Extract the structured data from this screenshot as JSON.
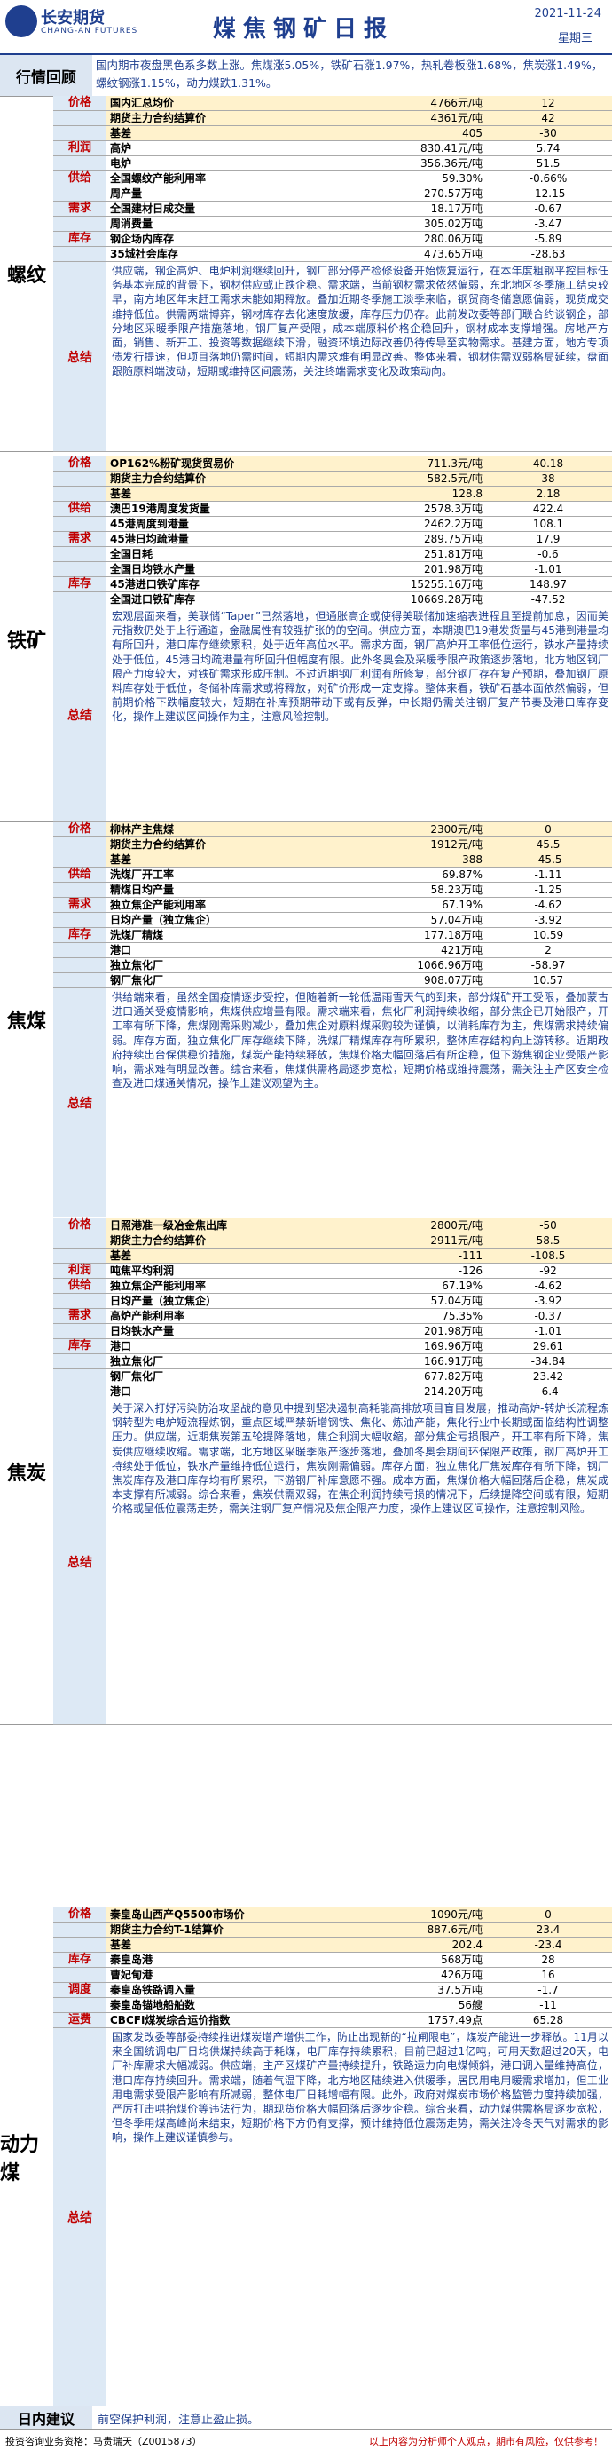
{
  "header": {
    "company_cn": "长安期货",
    "company_en": "CHANG-AN FUTURES",
    "title": "煤焦钢矿日报",
    "date": "2021-11-24",
    "weekday": "星期三"
  },
  "review": {
    "label": "行情回顾",
    "text": "国内期市夜盘黑色系多数上涨。焦煤涨5.05%，铁矿石涨1.97%，热轧卷板涨1.68%，焦炭涨1.49%，螺纹钢涨1.15%，动力煤跌1.31%。"
  },
  "sections": [
    {
      "name": "螺纹",
      "rows": [
        {
          "cat": "价格",
          "label": "国内汇总均价",
          "value": "4766元/吨",
          "change": "12",
          "hl": true
        },
        {
          "cat": "价格",
          "label": "期货主力合约结算价",
          "value": "4361元/吨",
          "change": "42",
          "hl": true
        },
        {
          "cat": "价格",
          "label": "基差",
          "value": "405",
          "change": "-30",
          "hl": true
        },
        {
          "cat": "利润",
          "label": "高炉",
          "value": "830.41元/吨",
          "change": "5.74",
          "hl": false
        },
        {
          "cat": "利润",
          "label": "电炉",
          "value": "356.36元/吨",
          "change": "51.5",
          "hl": false
        },
        {
          "cat": "供给",
          "label": "全国螺纹产能利用率",
          "value": "59.30%",
          "change": "-0.66%",
          "hl": false
        },
        {
          "cat": "供给",
          "label": "周产量",
          "value": "270.57万吨",
          "change": "-12.15",
          "hl": false
        },
        {
          "cat": "需求",
          "label": "全国建材日成交量",
          "value": "18.17万吨",
          "change": "-0.67",
          "hl": false
        },
        {
          "cat": "需求",
          "label": "周消费量",
          "value": "305.02万吨",
          "change": "-3.47",
          "hl": false
        },
        {
          "cat": "库存",
          "label": "钢企场内库存",
          "value": "280.06万吨",
          "change": "-5.89",
          "hl": false
        },
        {
          "cat": "库存",
          "label": "35城社会库存",
          "value": "473.65万吨",
          "change": "-28.63",
          "hl": false
        }
      ],
      "summary_label": "总结",
      "summary": "供应端，钢企高炉、电炉利润继续回升，钢厂部分停产检修设备开始恢复运行，在本年度粗钢平控目标任务基本完成的背景下，钢材供应或止跌企稳。需求端，当前钢材需求依然偏弱，东北地区冬季施工结束较早，南方地区年末赶工需求未能如期释放。叠加近期冬季施工淡季来临，钢贸商冬储意愿偏弱，现货成交维持低位。供需两端博弈，钢材库存去化速度放缓，库存压力仍存。此前发改委等部门联合约谈钢企，部分地区采暖季限产措施落地，钢厂复产受限，成本端原料价格企稳回升，钢材成本支撑增强。房地产方面，销售、新开工、投资等数据继续下滑，融资环境边际改善仍待传导至实物需求。基建方面，地方专项债发行提速，但项目落地仍需时间，短期内需求难有明显改善。整体来看，钢材供需双弱格局延续，盘面跟随原料端波动，短期或维持区间震荡，关注终端需求变化及政策动向。"
    },
    {
      "name": "铁矿",
      "rows": [
        {
          "cat": "价格",
          "label": "OP162%粉矿现货贸易价",
          "value": "711.3元/吨",
          "change": "40.18",
          "hl": true
        },
        {
          "cat": "价格",
          "label": "期货主力合约结算价",
          "value": "582.5元/吨",
          "change": "38",
          "hl": true
        },
        {
          "cat": "价格",
          "label": "基差",
          "value": "128.8",
          "change": "2.18",
          "hl": true
        },
        {
          "cat": "供给",
          "label": "澳巴19港周度发货量",
          "value": "2578.3万吨",
          "change": "422.4",
          "hl": false
        },
        {
          "cat": "供给",
          "label": "45港周度到港量",
          "value": "2462.2万吨",
          "change": "108.1",
          "hl": false
        },
        {
          "cat": "需求",
          "label": "45港日均疏港量",
          "value": "289.75万吨",
          "change": "17.9",
          "hl": false
        },
        {
          "cat": "需求",
          "label": "全国日耗",
          "value": "251.81万吨",
          "change": "-0.6",
          "hl": false
        },
        {
          "cat": "需求",
          "label": "全国日均铁水产量",
          "value": "201.98万吨",
          "change": "-1.01",
          "hl": false
        },
        {
          "cat": "库存",
          "label": "45港进口铁矿库存",
          "value": "15255.16万吨",
          "change": "148.97",
          "hl": false
        },
        {
          "cat": "库存",
          "label": "全国进口铁矿库存",
          "value": "10669.28万吨",
          "change": "-47.52",
          "hl": false
        }
      ],
      "summary_label": "总结",
      "summary": "宏观层面来看，美联储“Taper”已然落地，但通胀高企或使得美联储加速缩表进程且至提前加息，因而美元指数仍处于上行通道，金融属性有较强扩张的的空间。供应方面，本期澳巴19港发货量与45港到港量均有所回升，港口库存继续累积，处于近年高位水平。需求方面，钢厂高炉开工率低位运行，铁水产量持续处于低位，45港日均疏港量有所回升但幅度有限。此外冬奥会及采暖季限产政策逐步落地，北方地区钢厂限产力度较大，对铁矿需求形成压制。不过近期钢厂利润有所修复，部分钢厂存在复产预期，叠加钢厂原料库存处于低位，冬储补库需求或将释放，对矿价形成一定支撑。整体来看，铁矿石基本面依然偏弱，但前期价格下跌幅度较大，短期在补库预期带动下或有反弹，中长期仍需关注钢厂复产节奏及港口库存变化，操作上建议区间操作为主，注意风险控制。"
    },
    {
      "name": "焦煤",
      "rows": [
        {
          "cat": "价格",
          "label": "柳林产主焦煤",
          "value": "2300元/吨",
          "change": "0",
          "hl": true
        },
        {
          "cat": "价格",
          "label": "期货主力合约结算价",
          "value": "1912元/吨",
          "change": "45.5",
          "hl": true
        },
        {
          "cat": "价格",
          "label": "基差",
          "value": "388",
          "change": "-45.5",
          "hl": true
        },
        {
          "cat": "供给",
          "label": "洗煤厂开工率",
          "value": "69.87%",
          "change": "-1.11",
          "hl": false
        },
        {
          "cat": "供给",
          "label": "精煤日均产量",
          "value": "58.23万吨",
          "change": "-1.25",
          "hl": false
        },
        {
          "cat": "需求",
          "label": "独立焦企产能利用率",
          "value": "67.19%",
          "change": "-4.62",
          "hl": false
        },
        {
          "cat": "需求",
          "label": "日均产量（独立焦企）",
          "value": "57.04万吨",
          "change": "-3.92",
          "hl": false
        },
        {
          "cat": "库存",
          "label": "洗煤厂精煤",
          "value": "177.18万吨",
          "change": "10.59",
          "hl": false
        },
        {
          "cat": "库存",
          "label": "港口",
          "value": "421万吨",
          "change": "2",
          "hl": false
        },
        {
          "cat": "库存",
          "label": "独立焦化厂",
          "value": "1066.96万吨",
          "change": "-58.97",
          "hl": false
        },
        {
          "cat": "库存",
          "label": "钢厂焦化厂",
          "value": "908.07万吨",
          "change": "10.57",
          "hl": false
        }
      ],
      "summary_label": "总结",
      "summary": "供给端来看，虽然全国疫情逐步受控，但随着新一轮低温雨雪天气的到来，部分煤矿开工受限，叠加蒙古进口通关受疫情影响，焦煤供应增量有限。需求端来看，焦化厂利润持续收缩，部分焦企已开始限产，开工率有所下降，焦煤刚需采购减少，叠加焦企对原料煤采购较为谨慎，以消耗库存为主，焦煤需求持续偏弱。库存方面，独立焦化厂库存继续下降，洗煤厂精煤库存有所累积，整体库存结构向上游转移。近期政府持续出台保供稳价措施，煤炭产能持续释放，焦煤价格大幅回落后有所企稳，但下游焦钢企业受限产影响，需求难有明显改善。综合来看，焦煤供需格局逐步宽松，短期价格或维持震荡，需关注主产区安全检查及进口煤通关情况，操作上建议观望为主。"
    },
    {
      "name": "焦炭",
      "rows": [
        {
          "cat": "价格",
          "label": "日照港准一级冶金焦出库",
          "value": "2800元/吨",
          "change": "-50",
          "hl": true
        },
        {
          "cat": "价格",
          "label": "期货主力合约结算价",
          "value": "2911元/吨",
          "change": "58.5",
          "hl": true
        },
        {
          "cat": "价格",
          "label": "基差",
          "value": "-111",
          "change": "-108.5",
          "hl": true
        },
        {
          "cat": "利润",
          "label": "吨焦平均利润",
          "value": "-126",
          "change": "-92",
          "hl": false
        },
        {
          "cat": "供给",
          "label": "独立焦企产能利用率",
          "value": "67.19%",
          "change": "-4.62",
          "hl": false
        },
        {
          "cat": "供给",
          "label": "日均产量（独立焦企）",
          "value": "57.04万吨",
          "change": "-3.92",
          "hl": false
        },
        {
          "cat": "需求",
          "label": "高炉产能利用率",
          "value": "75.35%",
          "change": "-0.37",
          "hl": false
        },
        {
          "cat": "需求",
          "label": "日均铁水产量",
          "value": "201.98万吨",
          "change": "-1.01",
          "hl": false
        },
        {
          "cat": "库存",
          "label": "港口",
          "value": "169.96万吨",
          "change": "29.61",
          "hl": false
        },
        {
          "cat": "库存",
          "label": "独立焦化厂",
          "value": "166.91万吨",
          "change": "-34.84",
          "hl": false
        },
        {
          "cat": "库存",
          "label": "钢厂焦化厂",
          "value": "677.82万吨",
          "change": "23.42",
          "hl": false
        },
        {
          "cat": "库存",
          "label": "港口",
          "value": "214.20万吨",
          "change": "-6.4",
          "hl": false
        }
      ],
      "summary_label": "总结",
      "summary": "关于深入打好污染防治攻坚战的意见中提到坚决遏制高耗能高排放项目盲目发展，推动高炉-转炉长流程炼钢转型为电炉短流程炼钢，重点区域严禁新增钢铁、焦化、炼油产能，焦化行业中长期或面临结构性调整压力。供应端，近期焦炭第五轮提降落地，焦企利润大幅收缩，部分焦企亏损限产，开工率有所下降，焦炭供应继续收缩。需求端，北方地区采暖季限产逐步落地，叠加冬奥会期间环保限产政策，钢厂高炉开工持续处于低位，铁水产量维持低位运行，焦炭刚需偏弱。库存方面，独立焦化厂焦炭库存有所下降，钢厂焦炭库存及港口库存均有所累积，下游钢厂补库意愿不强。成本方面，焦煤价格大幅回落后企稳，焦炭成本支撑有所减弱。综合来看，焦炭供需双弱，在焦企利润持续亏损的情况下，后续提降空间或有限，短期价格或呈低位震荡走势，需关注钢厂复产情况及焦企限产力度，操作上建议区间操作，注意控制风险。"
    },
    {
      "name": "动力煤",
      "rows": [
        {
          "cat": "价格",
          "label": "秦皇岛山西产Q5500市场价",
          "value": "1090元/吨",
          "change": "0",
          "hl": true
        },
        {
          "cat": "价格",
          "label": "期货主力合约T-1结算价",
          "value": "887.6元/吨",
          "change": "23.4",
          "hl": true
        },
        {
          "cat": "价格",
          "label": "基差",
          "value": "202.4",
          "change": "-23.4",
          "hl": true
        },
        {
          "cat": "库存",
          "label": "秦皇岛港",
          "value": "568万吨",
          "change": "28",
          "hl": false
        },
        {
          "cat": "库存",
          "label": "曹妃甸港",
          "value": "426万吨",
          "change": "16",
          "hl": false
        },
        {
          "cat": "调度",
          "label": "秦皇岛铁路调入量",
          "value": "37.5万吨",
          "change": "-1.7",
          "hl": false
        },
        {
          "cat": "调度",
          "label": "秦皇岛锚地船舶数",
          "value": "56艘",
          "change": "-11",
          "hl": false
        },
        {
          "cat": "运费",
          "label": "CBCFI煤炭综合运价指数",
          "value": "1757.49点",
          "change": "65.28",
          "hl": false
        }
      ],
      "summary_label": "总结",
      "summary": "国家发改委等部委持续推进煤炭增产增供工作，防止出现新的“拉闸限电”，煤炭产能进一步释放。11月以来全国统调电厂日均供煤持续高于耗煤，电厂库存持续累积，目前已超过1亿吨，可用天数超过20天，电厂补库需求大幅减弱。供应端，主产区煤矿产量持续提升，铁路运力向电煤倾斜，港口调入量维持高位，港口库存持续回升。需求端，随着气温下降，北方地区陆续进入供暖季，居民用电用暖需求增加，但工业用电需求受限产影响有所减弱，整体电厂日耗增幅有限。此外，政府对煤炭市场价格监管力度持续加强，严厉打击哄抬煤价等违法行为，期现货价格大幅回落后逐步企稳。综合来看，动力煤供需格局逐步宽松，但冬季用煤高峰尚未结束，短期价格下方仍有支撑，预计维持低位震荡走势，需关注冷冬天气对需求的影响，操作上建议谨慎参与。"
    }
  ],
  "advice": {
    "label": "日内建议",
    "text": "前空保护利润，注意止盈止损。"
  },
  "footer": {
    "left": "投资咨询业务资格：马贵瑞天（Z0015873）",
    "right": "以上内容为分析师个人观点，期市有风险，仅供参考！"
  }
}
